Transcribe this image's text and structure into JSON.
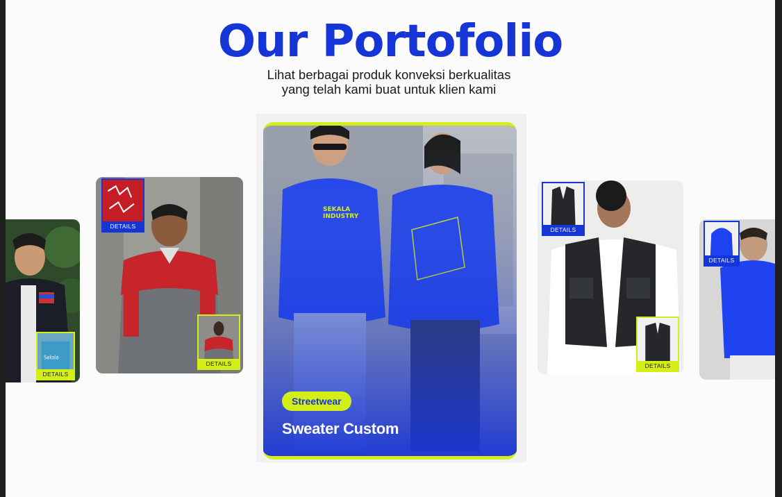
{
  "header": {
    "title": "Our Portofolio",
    "subtitle_line1": "Lihat berbagai produk konveksi berkualitas",
    "subtitle_line2": "yang telah kami buat untuk klien kami"
  },
  "cards": [
    {
      "name": "jacket",
      "detail_label": "DETAILS"
    },
    {
      "name": "polo-shirt",
      "detail_label_top": "DETAILS",
      "detail_label_bottom": "DETAILS"
    },
    {
      "name": "sweater",
      "category": "Streetwear",
      "title": "Sweater Custom",
      "brand_text": "SEKALA INDUSTRY"
    },
    {
      "name": "vest",
      "detail_label_top": "DETAILS",
      "detail_label_bottom": "DETAILS"
    },
    {
      "name": "hoodie",
      "detail_label": "DETAILS"
    }
  ],
  "colors": {
    "brand_blue": "#1535d6",
    "lime": "#d4ee1a",
    "background": "#fbfbfb"
  }
}
